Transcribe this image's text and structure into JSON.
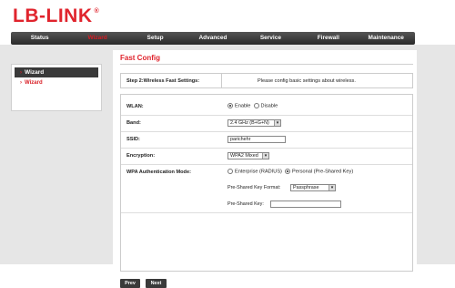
{
  "brand": {
    "logo_text": "LB-LINK",
    "reg_mark": "®"
  },
  "nav": {
    "items": [
      "Status",
      "Wizard",
      "Setup",
      "Advanced",
      "Service",
      "Firewall",
      "Maintenance"
    ],
    "active": "Wizard"
  },
  "sidebar": {
    "header": "Wizard",
    "items": [
      "Wizard"
    ]
  },
  "page": {
    "title": "Fast Config"
  },
  "step": {
    "label": "Step 2:Wireless Fast Settings:",
    "description": "Please config basic settings about wireless."
  },
  "form": {
    "wlan": {
      "label": "WLAN:",
      "enable": "Enable",
      "disable": "Disable",
      "selected": "Enable"
    },
    "band": {
      "label": "Band:",
      "value": "2.4 GHz (B+G+N)"
    },
    "ssid": {
      "label": "SSID:",
      "value": "parichehr"
    },
    "encryption": {
      "label": "Encryption:",
      "value": "WPA2 Mixed"
    },
    "wpa_auth": {
      "label": "WPA Authentication Mode:",
      "option1": "Enterprise (RADIUS)",
      "option2": "Personal (Pre-Shared Key)",
      "selected": "Personal (Pre-Shared Key)"
    },
    "psk_format": {
      "label": "Pre-Shared Key Format:",
      "value": "Passphrase"
    },
    "psk": {
      "label": "Pre-Shared Key:",
      "value": ""
    }
  },
  "buttons": {
    "prev": "Prev",
    "next": "Next"
  },
  "colors": {
    "accent": "#e0242d",
    "nav_bg": "#3a3a3a",
    "background": "#e6e6e6"
  }
}
